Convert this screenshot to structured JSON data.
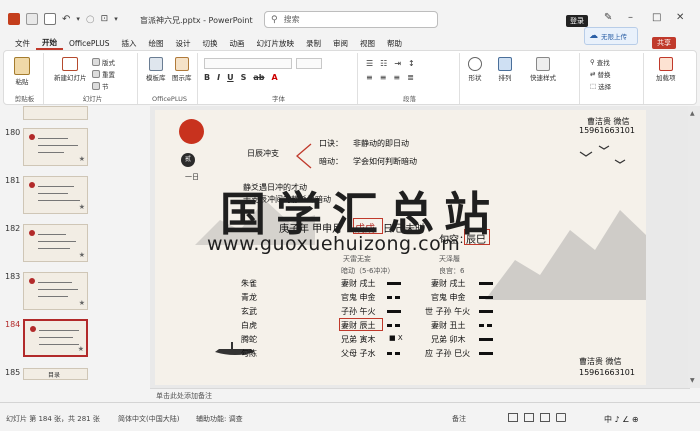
{
  "titlebar": {
    "doc_title": "盲派神六兄.pptx - PowerPoint",
    "search_placeholder": "搜索",
    "login_label": "登录",
    "cloud_label": "无限上传"
  },
  "menu": {
    "items": [
      "文件",
      "开始",
      "OfficePLUS",
      "插入",
      "绘图",
      "设计",
      "切换",
      "动画",
      "幻灯片放映",
      "录制",
      "审阅",
      "视图",
      "帮助"
    ],
    "active_index": 1,
    "share_label": "共享"
  },
  "ribbon": {
    "groups": [
      {
        "label": "剪贴板",
        "buttons": [
          "粘贴"
        ]
      },
      {
        "label": "幻灯片",
        "buttons": [
          "新建幻灯片",
          "版式",
          "重置",
          "节"
        ]
      },
      {
        "label": "OfficePLUS",
        "buttons": [
          "模板库",
          "图示库"
        ]
      },
      {
        "label": "字体",
        "buttons": []
      },
      {
        "label": "段落",
        "buttons": []
      },
      {
        "label": "",
        "buttons": [
          "形状",
          "排列",
          "快速样式"
        ]
      },
      {
        "label": "",
        "buttons": [
          "查找",
          "替换",
          "选择"
        ]
      },
      {
        "label": "",
        "buttons": [
          "加载项"
        ]
      }
    ]
  },
  "thumbnails": [
    {
      "num": "180",
      "selected": false
    },
    {
      "num": "181",
      "selected": false
    },
    {
      "num": "182",
      "selected": false
    },
    {
      "num": "183",
      "selected": false
    },
    {
      "num": "184",
      "selected": true
    },
    {
      "num": "185",
      "selected": false,
      "title": "目录"
    }
  ],
  "slide": {
    "seal_char": "贰",
    "vertical_text": "一日",
    "header_left": "日辰冲支",
    "rule1_label": "口诀：",
    "rule1_text": "非静动的即日动",
    "rule2_label": "暗动：",
    "rule2_text": "学会如何判断暗动",
    "note1": "静爻遇日冲的才动",
    "note2": "干支辰冲间的静爻为暗动",
    "date_prefix": "庚子年 甲申月",
    "date_mid": "戊戌",
    "date_suffix": "日",
    "hour": "己未时",
    "void_label": "旬空：",
    "void_value": "辰巳",
    "left_hexagram": "天雷无妄",
    "left_note": "暗动（5-6冲冲）",
    "right_hexagram": "天泽履",
    "right_note": "良宫：6",
    "six_spirits": [
      "朱雀",
      "青龙",
      "玄武",
      "白虎",
      "腾蛇",
      "勾陈"
    ],
    "left_lines": [
      "妻财 戌土",
      "官鬼 申金",
      "子孙 午火",
      "妻财 辰土",
      "兄弟 寅木",
      "父母 子水"
    ],
    "left_marks": [
      "",
      "",
      "",
      "",
      "■ X",
      ""
    ],
    "right_lines": [
      "妻财 戌土",
      "官鬼 申金",
      "世 子孙 午火",
      "妻财 丑土",
      "兄弟 卯木",
      "应 子孙 巳火"
    ],
    "teacher_top": "曹洁贵 微信",
    "phone_top": "15961663101",
    "teacher_bottom": "曹洁贵 微信",
    "phone_bottom": "15961663101"
  },
  "watermark": {
    "chinese": "国学汇总站",
    "url": "www.guoxuehuizong.com"
  },
  "notes_placeholder": "单击此处添加备注",
  "status": {
    "slide_info": "幻灯片 第 184 张，共 281 张",
    "language": "简体中文(中国大陆)",
    "accessibility": "辅助功能: 调查",
    "notes_label": "备注",
    "tray": "中 ♪ ∠ ⊕"
  }
}
